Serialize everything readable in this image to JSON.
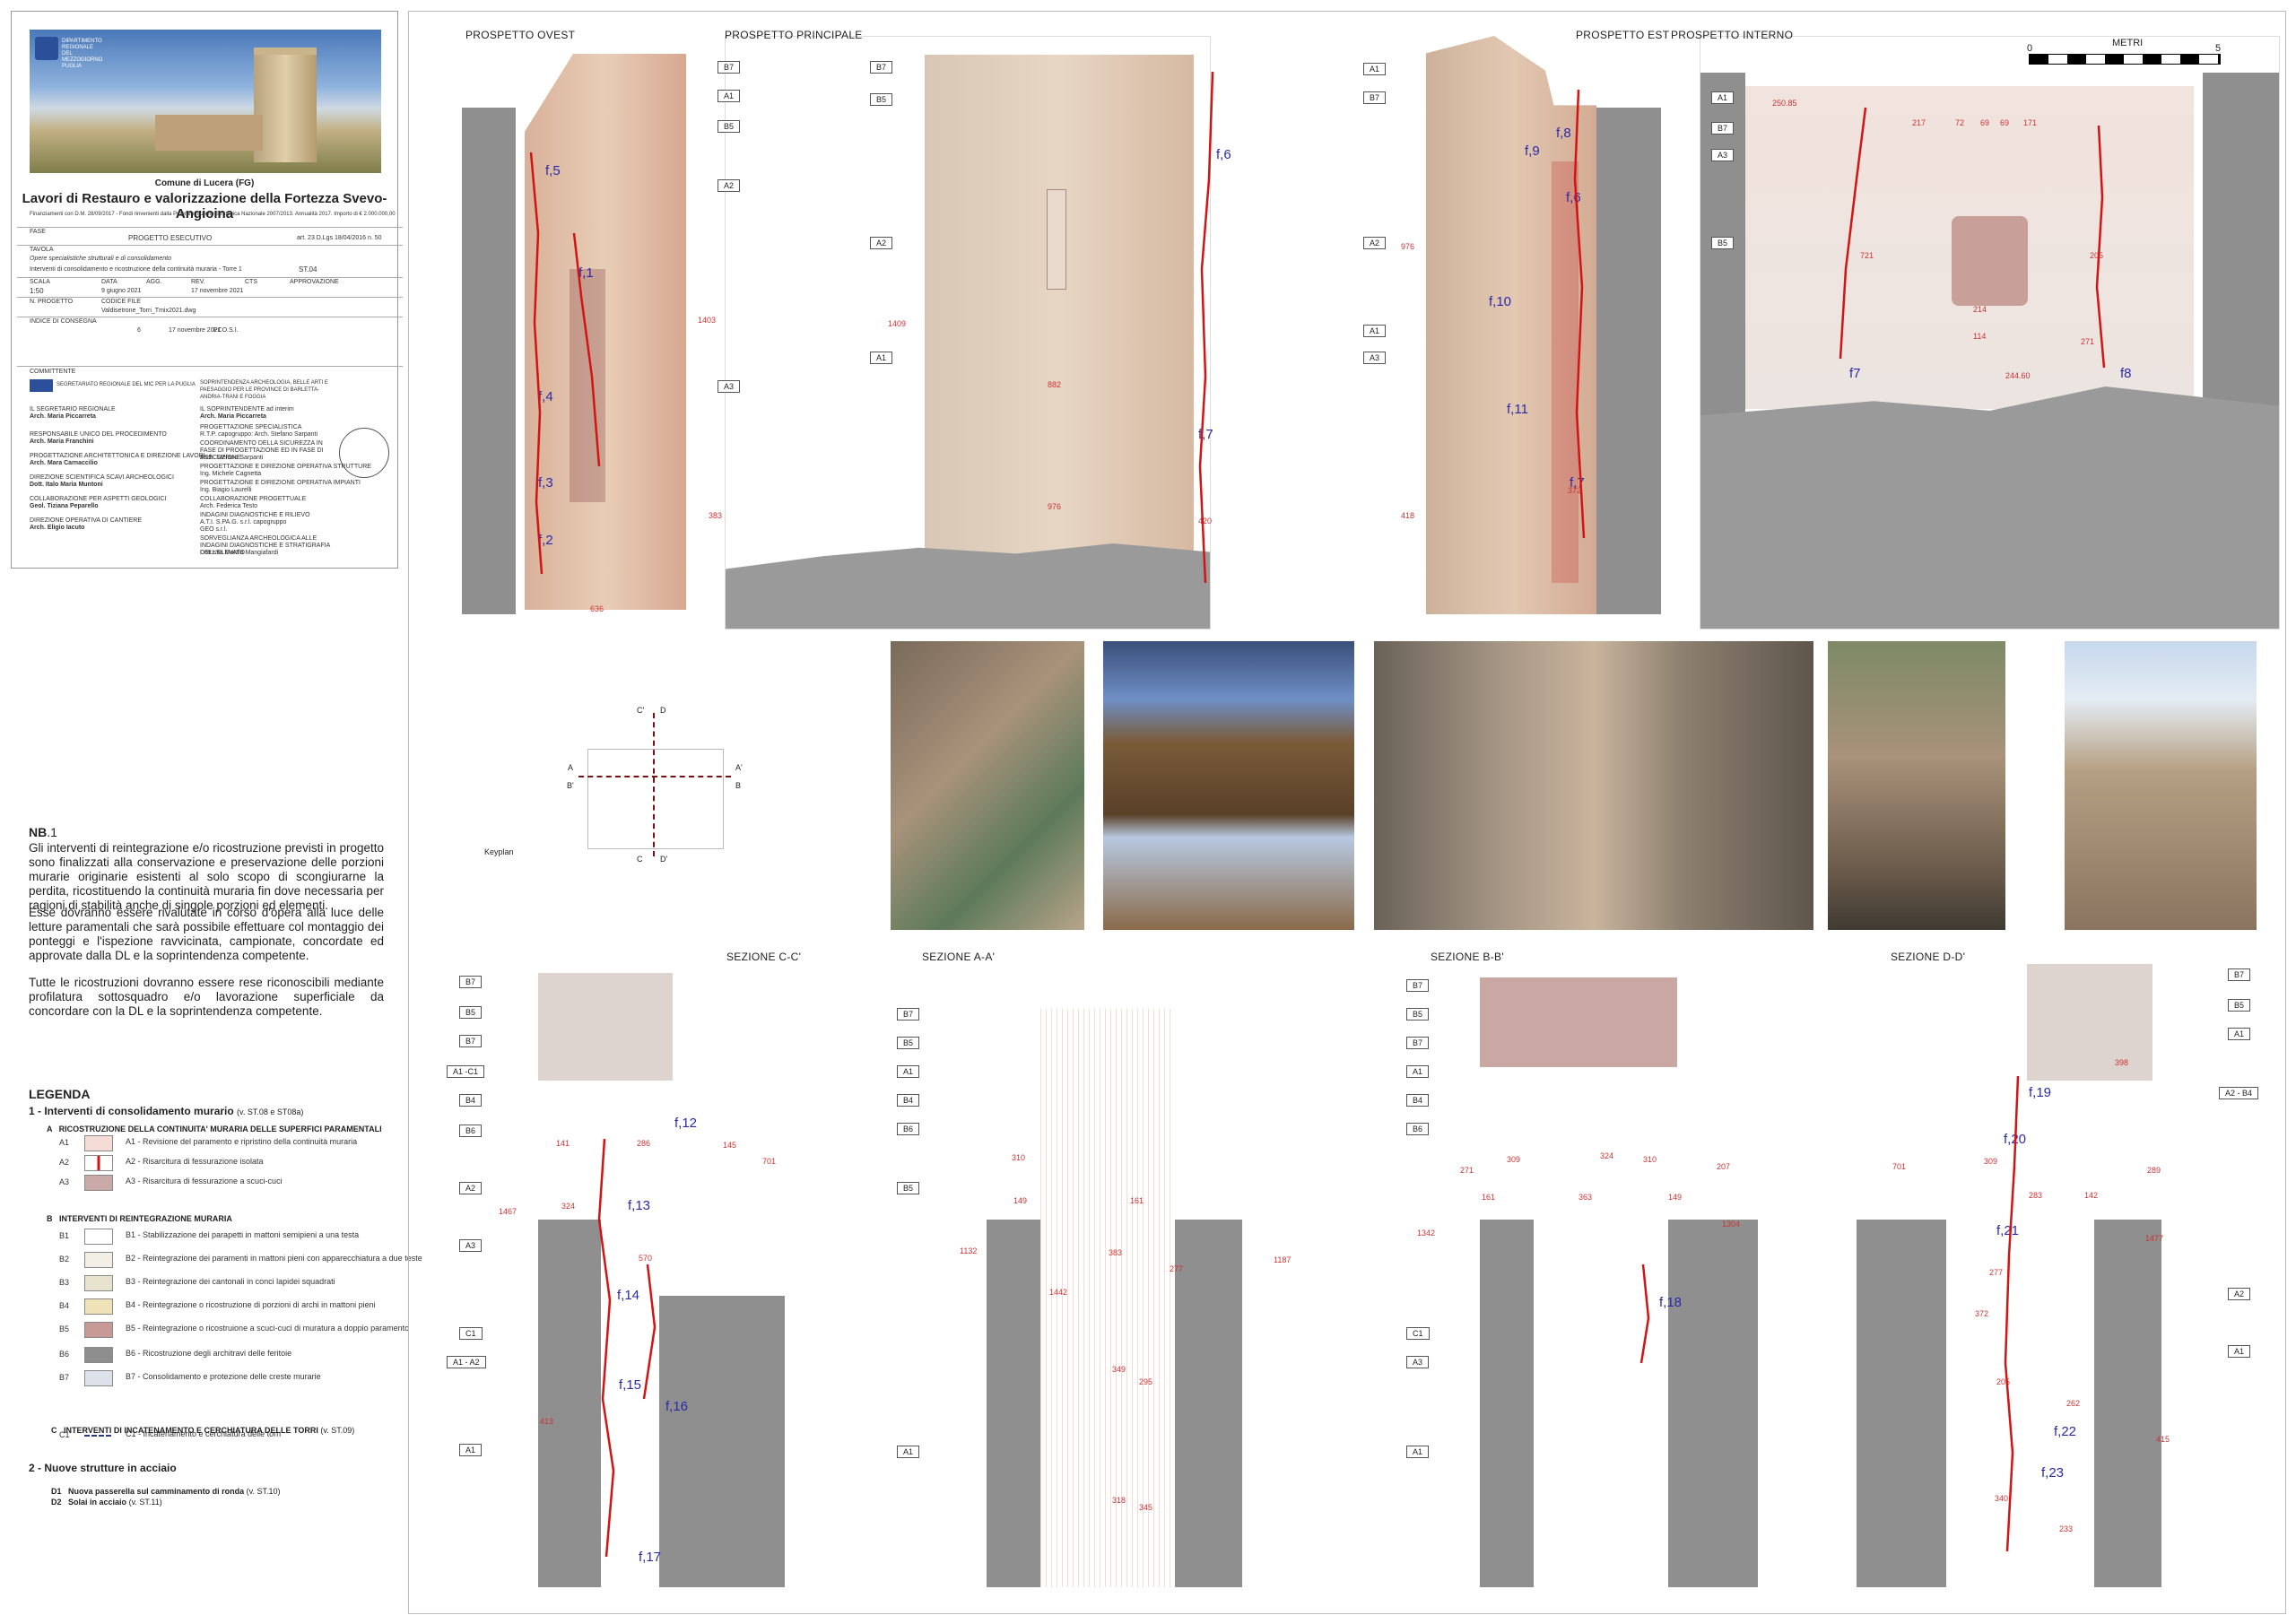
{
  "title_block": {
    "logo": "DIPARTIMENTO REGIONALE DEL MEZZOGIORNO PUGLIA",
    "municipality": "Comune di Lucera (FG)",
    "project_title": "Lavori di Restauro e valorizzazione della Fortezza Svevo-Angioina",
    "funding": "Finanziamenti con D.M. 28/09/2017 - Fondi rinvenienti dalla Programmazione Strategica Nazionale 2007/2013. Annualità 2017. Importo di € 2.000.000,00",
    "phase_label": "FASE",
    "phase": "PROGETTO ESECUTIVO",
    "law_ref": "art. 23 D.Lgs 18/04/2016 n. 50",
    "table_label": "TAVOLA",
    "table_desc1": "Opere specialistiche strutturali e di consolidamento",
    "table_desc2": "Interventi di consolidamento e ricostruzione della continuità muraria - Torre 1",
    "table_num": "ST.04",
    "scale_label": "SCALA",
    "scale": "1:50",
    "data_label": "DATA",
    "data": "9 giugno 2021",
    "agg_label": "AGG.",
    "rev_label": "REV.",
    "rev_date": "17 novembre 2021",
    "cts_label": "CTS",
    "approv_label": "APPROVAZIONE",
    "progetto_label": "N. PROGETTO",
    "file_label": "CODICE FILE",
    "file": "Valdisetrone_Torri_Tmix2021.dwg",
    "indice_label": "INDICE DI CONSEGNA",
    "rev_row": "6",
    "rev_row_date": "17 novembre 2021",
    "rev_row_code": "PCO.S.I.",
    "committente_label": "COMMITTENTE",
    "committente": "SEGRETARIATO REGIONALE DEL MIC PER LA PUGLIA",
    "sovr_label": "SOPRINTENDENZA ARCHEOLOGIA, BELLE ARTI E PAESAGGIO PER LE PROVINCE DI BARLETTA-ANDRIA-TRANI E FOGGIA",
    "secretary_label": "IL SEGRETARIO REGIONALE",
    "secretary": "Arch. Maria Piccarreta",
    "soprintendente_label": "IL SOPRINTENDENTE ad interim",
    "soprintendente": "Arch. Maria Piccarreta",
    "staff": [
      "RESPONSABILE UNICO DEL PROCEDIMENTO",
      "Arch. Maria Franchini",
      "PROGETTAZIONE ARCHITETTONICA E DIREZIONE LAVORI",
      "Arch. Mara Carnaccilio",
      "DIREZIONE SCIENTIFICA SCAVI ARCHEOLOGICI",
      "Dott. Italo Maria Muntoni",
      "COLLABORAZIONE PER ASPETTI GEOLOGICI",
      "Geol. Tiziana Peparello",
      "DIREZIONE OPERATIVA DI CANTIERE",
      "Arch. Eligio Iacuto"
    ],
    "consultants": [
      "PROGETTAZIONE SPECIALISTICA",
      "R.T.P. capogruppo: Arch. Stefano Sarpanti",
      "COORDINAMENTO DELLA SICUREZZA IN FASE DI PROGETTAZIONE ED IN FASE DI ESECUZIONE",
      "Arch. Stefano Sarpanti",
      "PROGETTAZIONE E DIREZIONE OPERATIVA STRUTTURE",
      "Ing. Michele Cagnetta",
      "PROGETTAZIONE E DIREZIONE OPERATIVA IMPIANTI",
      "Ing. Biagio Laurelli",
      "COLLABORAZIONE PROGETTUALE",
      "Arch. Federica Testo",
      "INDAGINI DIAGNOSTICHE E RILIEVO",
      "A.T.I. S.PA.G. s.r.l. capogruppo",
      "GEO s.r.l.",
      "SORVEGLIANZA ARCHEOLOGICA ALLE INDAGINI DIAGNOSTICHE E STRATIGRAFIA DELL'ELEVATO",
      "Dott.ssa Marzia Mangiafardi"
    ]
  },
  "notes": {
    "nb_title": "NB",
    "nb_num": ".1",
    "p1": "Gli interventi di reintegrazione e/o ricostruzione previsti in progetto sono finalizzati alla conservazione e preservazione delle porzioni murarie originarie esistenti al solo scopo di scongiurarne la perdita, ricostituendo la continuità muraria fin dove necessaria per ragioni di stabilità anche di singole porzioni ed elementi.",
    "p2": "Esse dovranno essere rivalutate in corso d'opera alla luce delle letture paramentali che sarà possibile effettuare col montaggio dei ponteggi e l'ispezione ravvicinata, campionate, concordate ed approvate dalla DL e la soprintendenza competente.",
    "p3": "Tutte le ricostruzioni dovranno essere rese riconoscibili mediante profilatura sottosquadro e/o lavorazione superficiale da concordare con la DL e la soprintendenza competente."
  },
  "legend": {
    "title": "LEGENDA",
    "s1_title": "1 - Interventi di consolidamento murario",
    "s1_ref": "(v. ST.08 e ST08a)",
    "a_head": "A   RICOSTRUZIONE DELLA CONTINUITA' MURARIA DELLE SUPERFICI PARAMENTALI",
    "b_head": "B   INTERVENTI DI REINTEGRAZIONE MURARIA",
    "c_head": "C   INTERVENTI DI INCATENAMENTO E CERCHIATURA DELLE TORRI",
    "c_ref": "(v. ST.09)",
    "items": [
      {
        "code": "A1",
        "text": "A1 - Revisione del paramento e ripristino della continuità muraria",
        "fill": "#f6dcd6"
      },
      {
        "code": "A2",
        "text": "A2 - Risarcitura di fessurazione isolata",
        "fill": "#ffffff"
      },
      {
        "code": "A3",
        "text": "A3 - Risarcitura di fessurazione a scuci-cuci",
        "fill": "#c9aaa8"
      },
      {
        "code": "B1",
        "text": "B1 - Stabilizzazione dei parapetti in mattoni semipieni a una testa",
        "fill": "#ffffff"
      },
      {
        "code": "B2",
        "text": "B2 - Reintegrazione dei paramenti in mattoni pieni con apparecchiatura a due teste",
        "fill": "#f3eee6"
      },
      {
        "code": "B3",
        "text": "B3 - Reintegrazione dei cantonali in conci lapidei squadrati",
        "fill": "#e8e3cf"
      },
      {
        "code": "B4",
        "text": "B4 - Reintegrazione o ricostruzione di porzioni di archi in mattoni pieni",
        "fill": "#efe2b8"
      },
      {
        "code": "B5",
        "text": "B5 - Reintegrazione o ricostruione a scuci-cuci di muratura a doppio paramento",
        "fill": "#c89a96"
      },
      {
        "code": "B6",
        "text": "B6 - Ricostruzione degli architravi delle feritoie",
        "fill": "#8e8e8e"
      },
      {
        "code": "B7",
        "text": "B7 - Consolidamento e protezione delle creste murarie",
        "fill": "#dde2ea"
      },
      {
        "code": "C1",
        "text": "C1 - Incatenamento e cerchiatura delle torri",
        "fill": "#ffffff"
      }
    ],
    "s2_title": "2 - Nuove strutture in acciaio",
    "d1": "D1   Nuova passerella sul camminamento di ronda",
    "d1_ref": "(v. ST.10)",
    "d2": "D2   Solai in acciaio",
    "d2_ref": "(v. ST.11)"
  },
  "elevations": {
    "ovest": "PROSPETTO OVEST",
    "principale": "PROSPETTO PRINCIPALE",
    "est": "PROSPETTO EST",
    "interno": "PROSPETTO INTERNO",
    "scale_title": "METRI",
    "scale_0": "0",
    "scale_5": "5"
  },
  "sections": {
    "cc": "SEZIONE C-C'",
    "aa": "SEZIONE A-A'",
    "bb": "SEZIONE B-B'",
    "dd": "SEZIONE D-D'"
  },
  "keyplan": {
    "label": "Keyplan",
    "c": "C'",
    "d": "D",
    "a": "A",
    "a2": "A'",
    "b": "B'",
    "b2": "B",
    "c2": "C",
    "d2": "D'"
  },
  "tags": {
    "ovest": [
      "B7",
      "A1",
      "B5",
      "A2",
      "A3"
    ],
    "principale": [
      "B7",
      "B5",
      "A2",
      "A1"
    ],
    "est": [
      "A1",
      "B7",
      "A2",
      "A1",
      "A3"
    ],
    "interno": [
      "A1",
      "B7",
      "A3",
      "B5"
    ],
    "cc": [
      "B7",
      "B5",
      "B7",
      "A1 -C1",
      "B4",
      "B6",
      "A2",
      "A3",
      "C1",
      "A1 - A2",
      "A1"
    ],
    "aa": [
      "B7",
      "B5",
      "A1",
      "B4",
      "B6",
      "B5",
      "A1"
    ],
    "bb": [
      "B7",
      "B5",
      "B7",
      "A1",
      "B4",
      "B6",
      "C1",
      "A3",
      "A1"
    ],
    "dd": [
      "B7",
      "B5",
      "A1",
      "A2 - B4",
      "A2",
      "A1"
    ]
  },
  "cracks": {
    "ovest": [
      "f,5",
      "f,1",
      "f,4",
      "f,3",
      "f,2"
    ],
    "principale": [
      "f,6",
      "f,7"
    ],
    "est": [
      "f,8",
      "f,9",
      "f,6",
      "f,10",
      "f,11",
      "f,7"
    ],
    "interno": [
      "f7",
      "f8"
    ],
    "cc": [
      "f,12",
      "f,13",
      "f,14",
      "f,15",
      "f,16",
      "f,17"
    ],
    "bb": [
      "f,18"
    ],
    "dd": [
      "f,19",
      "f,20",
      "f,21",
      "f,22",
      "f,23"
    ]
  },
  "dims": {
    "ovest": [
      "1403",
      "383",
      "636"
    ],
    "principale": [
      "1409",
      "420",
      "882",
      "976"
    ],
    "est": [
      "976",
      "418",
      "372"
    ],
    "interno": [
      "217",
      "72",
      "69",
      "69",
      "171",
      "250.85",
      "721",
      "205",
      "214",
      "114",
      "271",
      "244.60"
    ],
    "cc": [
      "141",
      "286",
      "145",
      "324",
      "570",
      "701",
      "1467",
      "413"
    ],
    "aa": [
      "310",
      "149",
      "161",
      "383",
      "1132",
      "1442",
      "277",
      "1187",
      "349",
      "295",
      "318",
      "345"
    ],
    "bb": [
      "271",
      "309",
      "324",
      "310",
      "207",
      "161",
      "363",
      "149",
      "1342",
      "1304"
    ],
    "dd": [
      "398",
      "289",
      "1477",
      "283",
      "142",
      "701",
      "309",
      "277",
      "372",
      "205",
      "262",
      "415",
      "340",
      "233"
    ]
  },
  "colors": {
    "crack": "#d21414",
    "tag_ink": "#222222",
    "crack_label": "#2a2aa8",
    "dim_ink": "#cc3333",
    "wall_grey": "#8f8f8f",
    "brick": "#d9a98e"
  }
}
